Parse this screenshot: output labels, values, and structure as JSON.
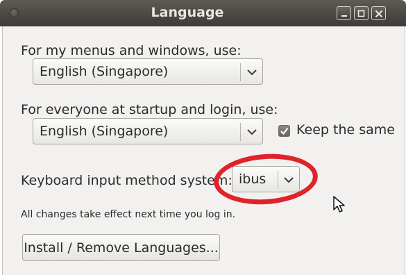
{
  "window": {
    "title": "Language"
  },
  "menus_section": {
    "label": "For my menus and windows, use:",
    "selected": "English (Singapore)"
  },
  "startup_section": {
    "label": "For everyone at startup and login, use:",
    "selected": "English (Singapore)",
    "keep_same_label": "Keep the same",
    "keep_same_checked": true
  },
  "input_method": {
    "label": "Keyboard input method system:",
    "selected": "ibus"
  },
  "notice": "All changes take effect next time you log in.",
  "install_button": "Install / Remove Languages...",
  "colors": {
    "annotation_circle": "#e0232b",
    "titlebar": "#4b4944",
    "dialog_bg": "#f2f1ef"
  }
}
